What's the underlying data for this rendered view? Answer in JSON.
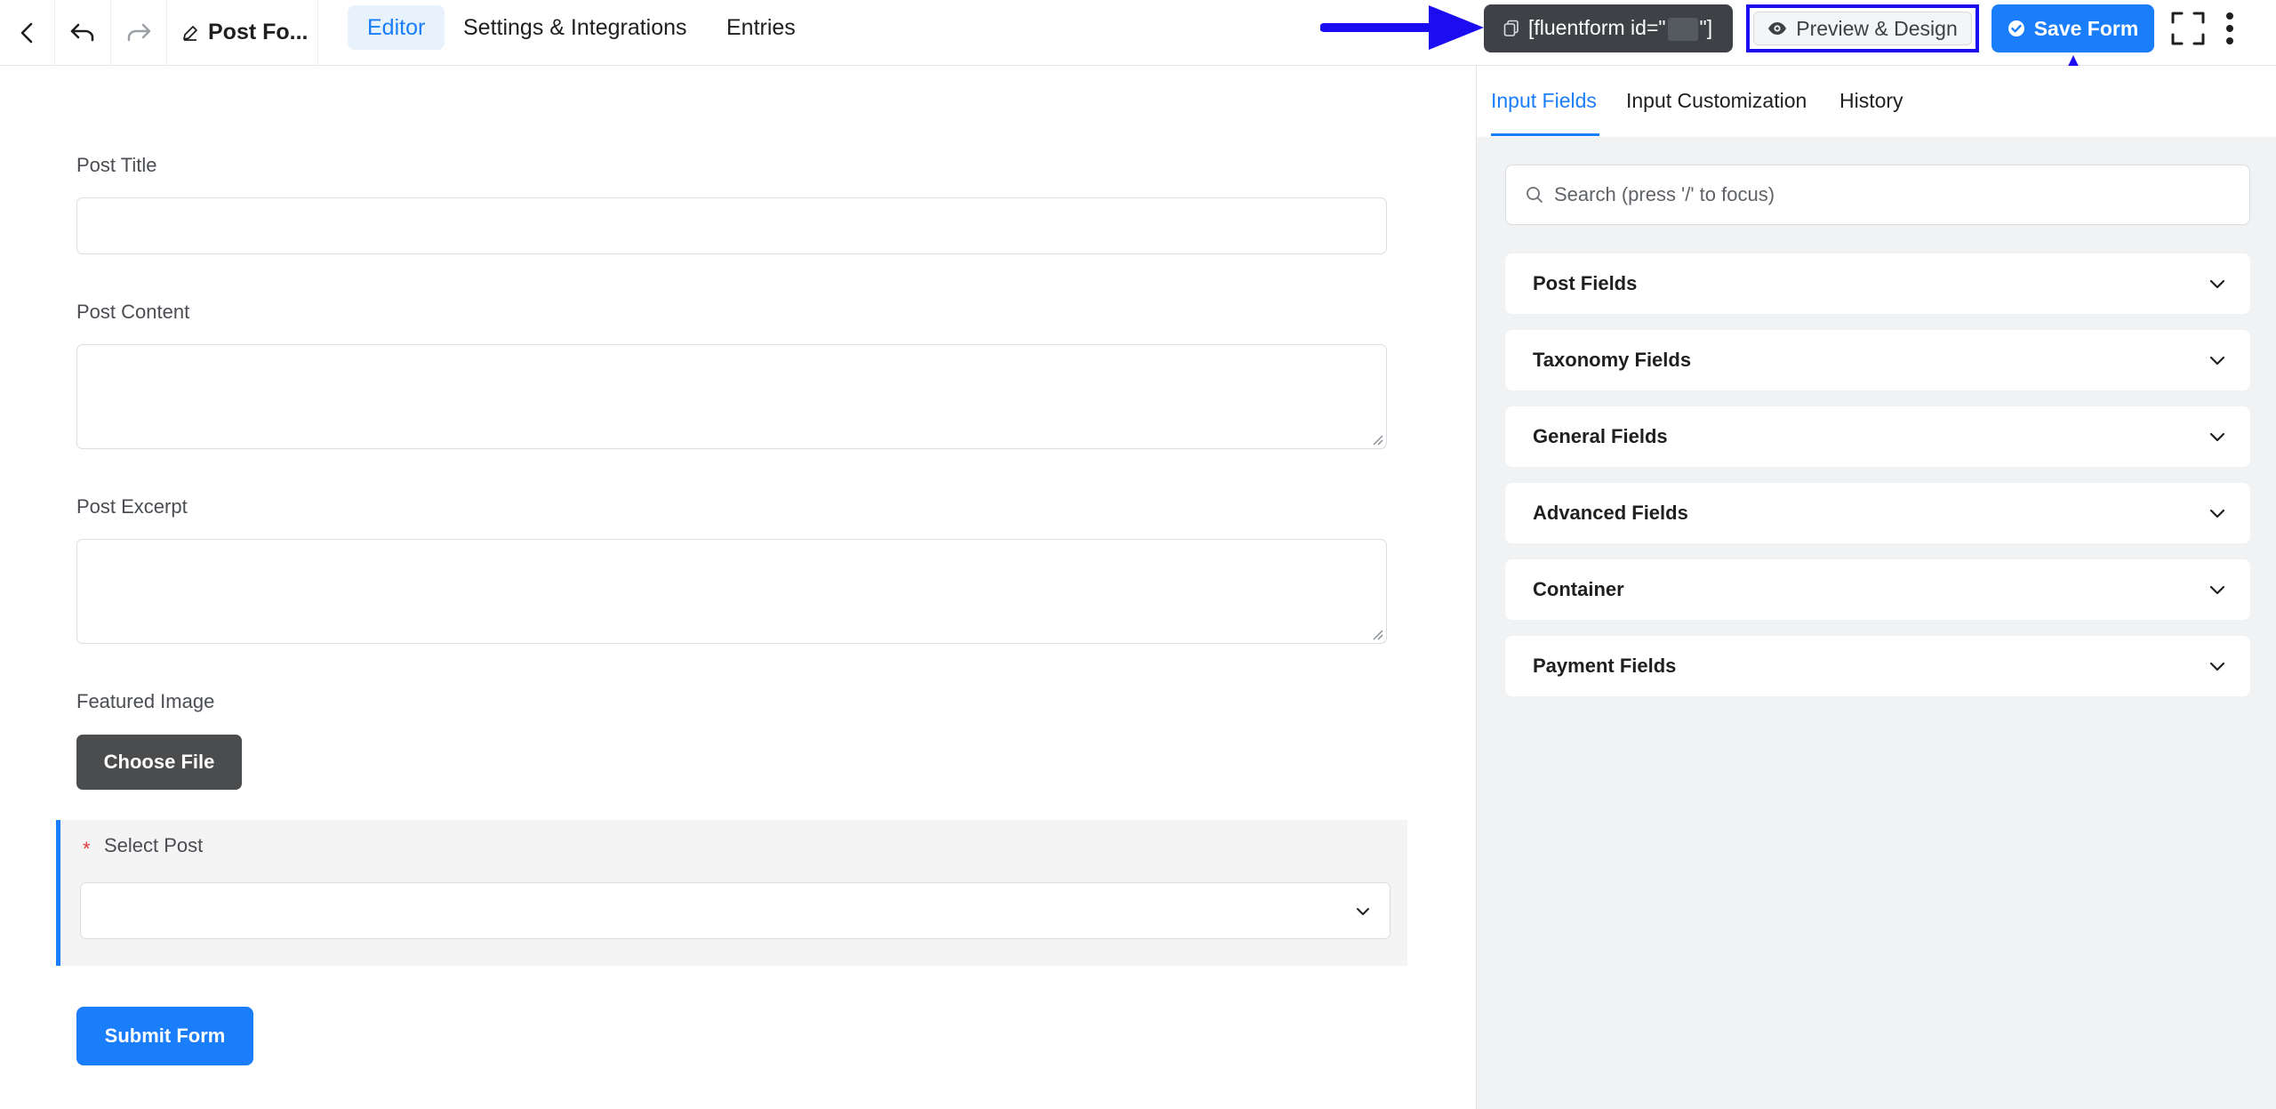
{
  "topbar": {
    "form_title": "Post Fo...",
    "nav_tabs": [
      "Editor",
      "Settings & Integrations",
      "Entries"
    ],
    "active_tab": "Editor",
    "shortcode_prefix": "[fluentform id=\"",
    "shortcode_suffix": "\"]",
    "preview_label": "Preview & Design",
    "save_label": "Save Form"
  },
  "form": {
    "post_title_label": "Post Title",
    "post_content_label": "Post Content",
    "post_excerpt_label": "Post Excerpt",
    "featured_image_label": "Featured Image",
    "choose_file_label": "Choose File",
    "select_post_required_mark": "*",
    "select_post_label": "Select Post",
    "submit_label": "Submit Form"
  },
  "panel": {
    "tabs": [
      "Input Fields",
      "Input Customization",
      "History"
    ],
    "active_tab": "Input Fields",
    "search_placeholder": "Search (press '/' to focus)",
    "sections": [
      "Post Fields",
      "Taxonomy Fields",
      "General Fields",
      "Advanced Fields",
      "Container",
      "Payment Fields"
    ]
  },
  "colors": {
    "accent": "#1a7efb",
    "annotation": "#1b0df0",
    "dark_button": "#3e4246"
  },
  "icons": [
    "chevron-left-icon",
    "undo-icon",
    "redo-icon",
    "pencil-icon",
    "copy-icon",
    "eye-icon",
    "check-circle-icon",
    "fullscreen-icon",
    "kebab-menu-icon",
    "search-icon",
    "chevron-down-icon"
  ]
}
